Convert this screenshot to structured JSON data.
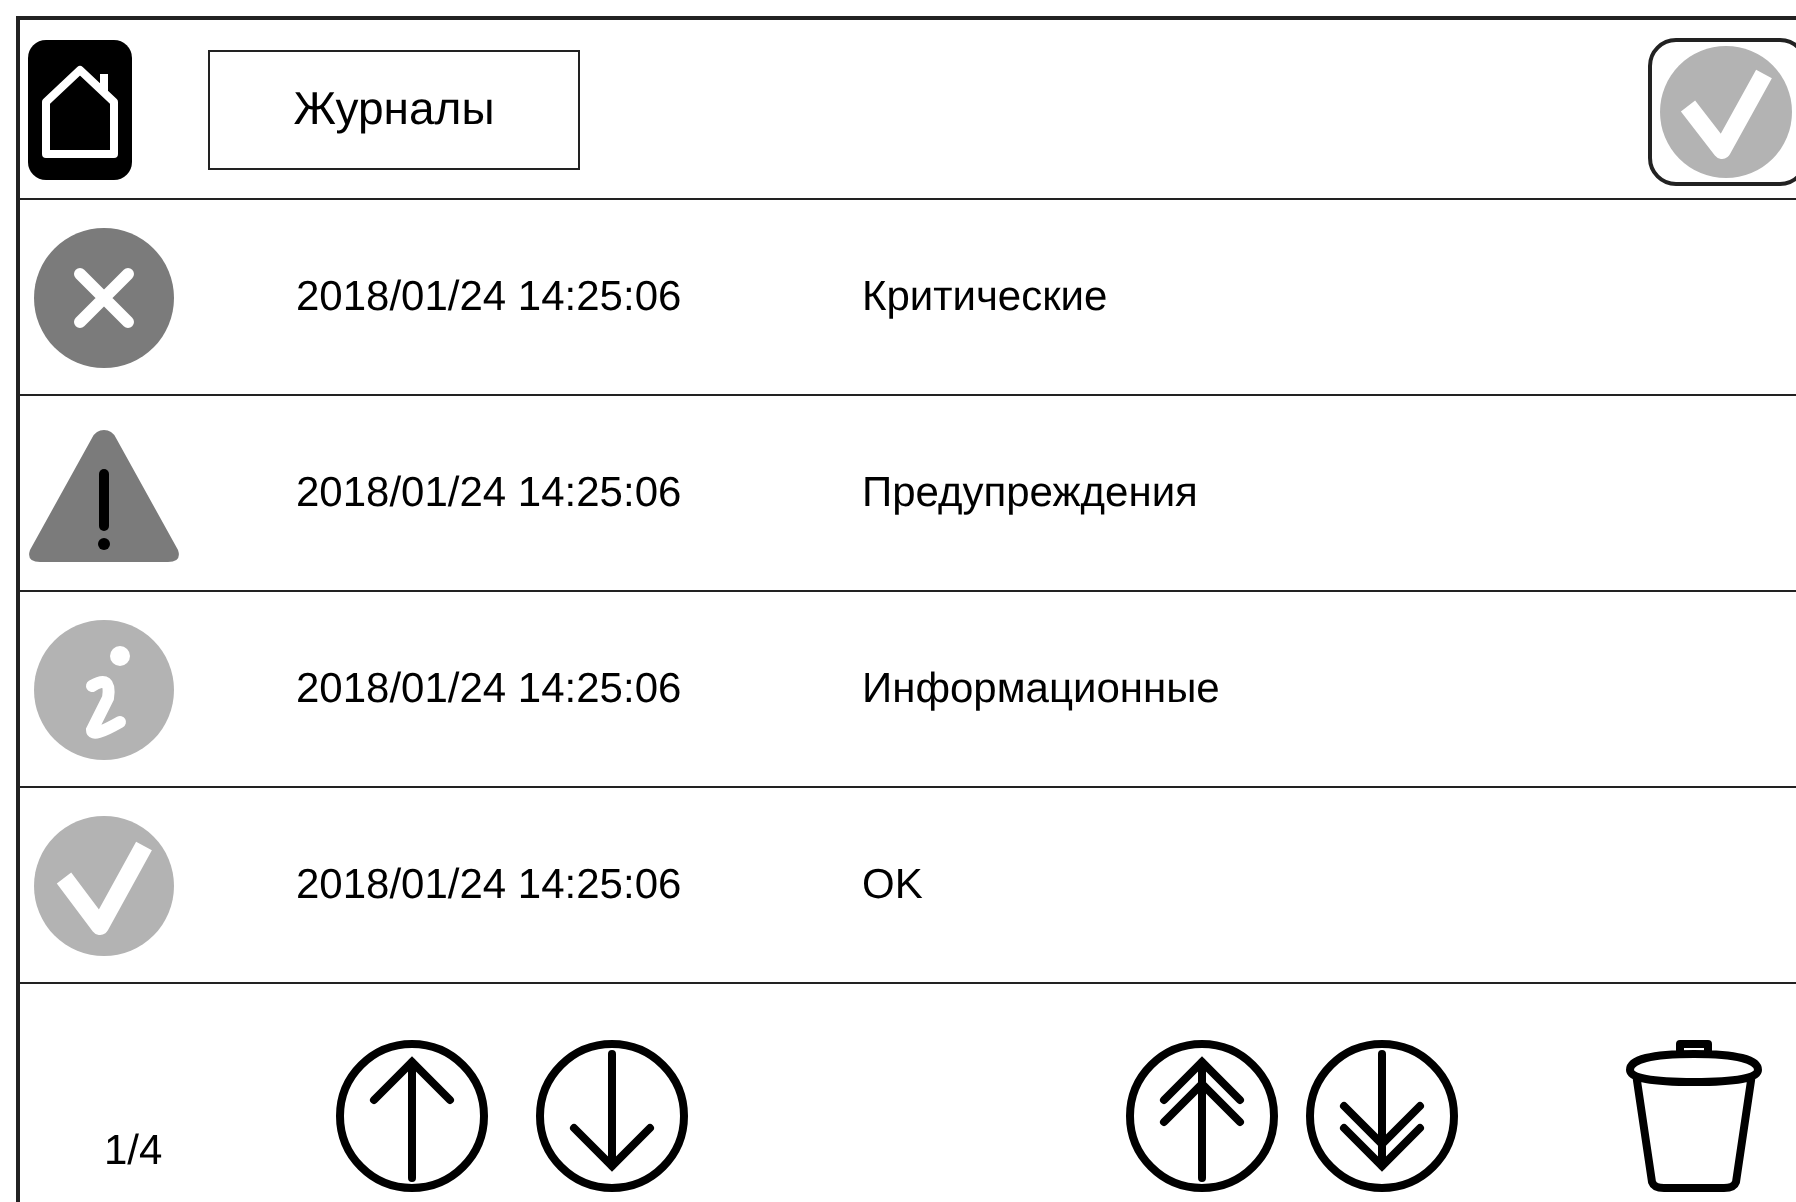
{
  "header": {
    "title": "Журналы"
  },
  "entries": [
    {
      "kind": "critical",
      "timestamp": "2018/01/24 14:25:06",
      "category": "Критические"
    },
    {
      "kind": "warning",
      "timestamp": "2018/01/24 14:25:06",
      "category": "Предупреждения"
    },
    {
      "kind": "info",
      "timestamp": "2018/01/24 14:25:06",
      "category": "Информационные"
    },
    {
      "kind": "ok",
      "timestamp": "2018/01/24 14:25:06",
      "category": "OK"
    }
  ],
  "footer": {
    "page": "1/4"
  }
}
